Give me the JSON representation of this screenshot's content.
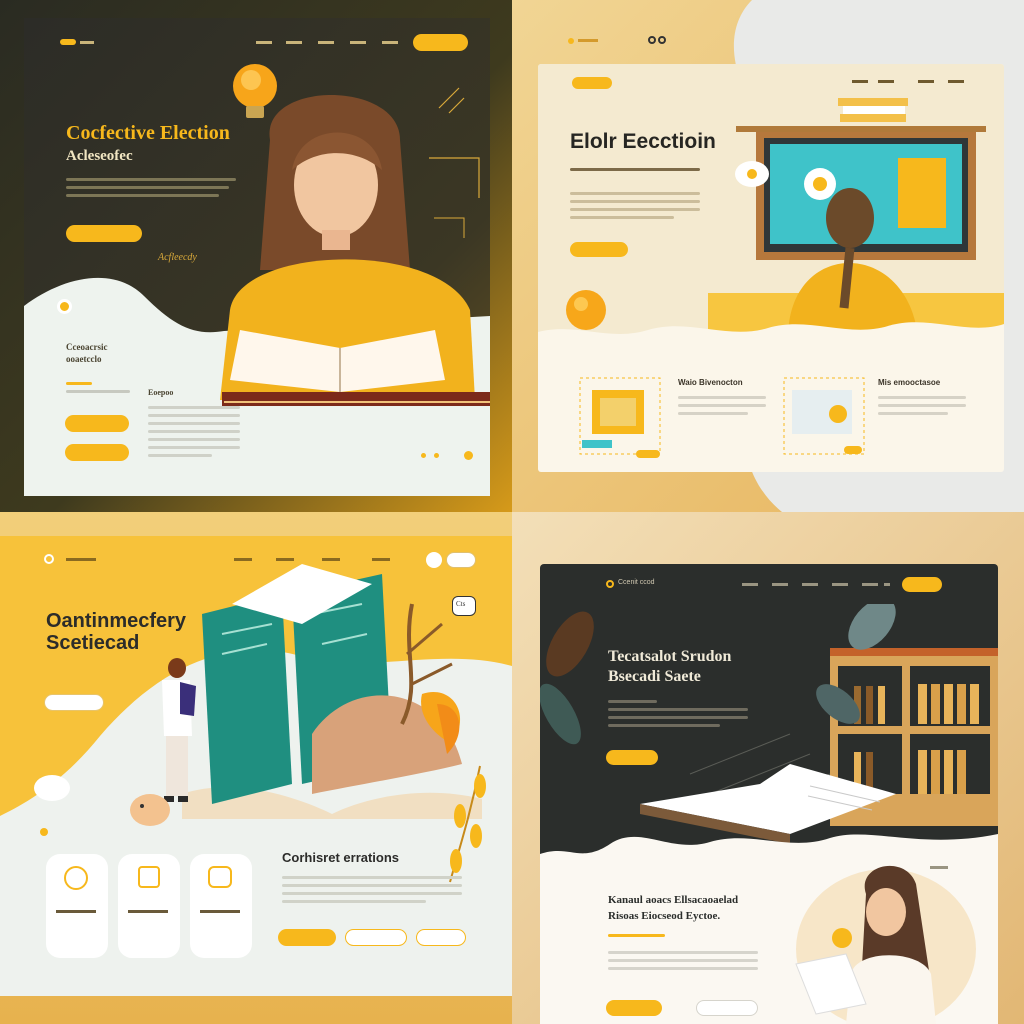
{
  "colors": {
    "accent": "#f7b81c",
    "dark": "#2b2e2c",
    "teal": "#1f8f80",
    "cream": "#f3e6c6"
  },
  "panel_tl": {
    "title": "Cocfective Election",
    "subtitle": "Acleseofec",
    "tagline": "Acfleecdy",
    "side_title": "Cceoacrsic",
    "side_sub": "ooaetcclo",
    "col_title": "Eoepoo"
  },
  "panel_tr": {
    "title": "Elolr Eecctioin",
    "card1_title": "Waio Bivenocton",
    "card2_title": "Mis emooctasoe"
  },
  "panel_bl": {
    "title_line1": "Oantinmecfery",
    "title_line2": "Scetiecad",
    "section_title": "Corhisret errations",
    "tag": "Cts"
  },
  "panel_br": {
    "logo": "Ccenit ccod",
    "title_line1": "Tecatsalot Srudon",
    "title_line2": "Bsecadi Saete",
    "sub_line1": "Kanaul aoacs Ellsacaoaelad",
    "sub_line2": "Risoas Eiocseod Eyctoe."
  }
}
